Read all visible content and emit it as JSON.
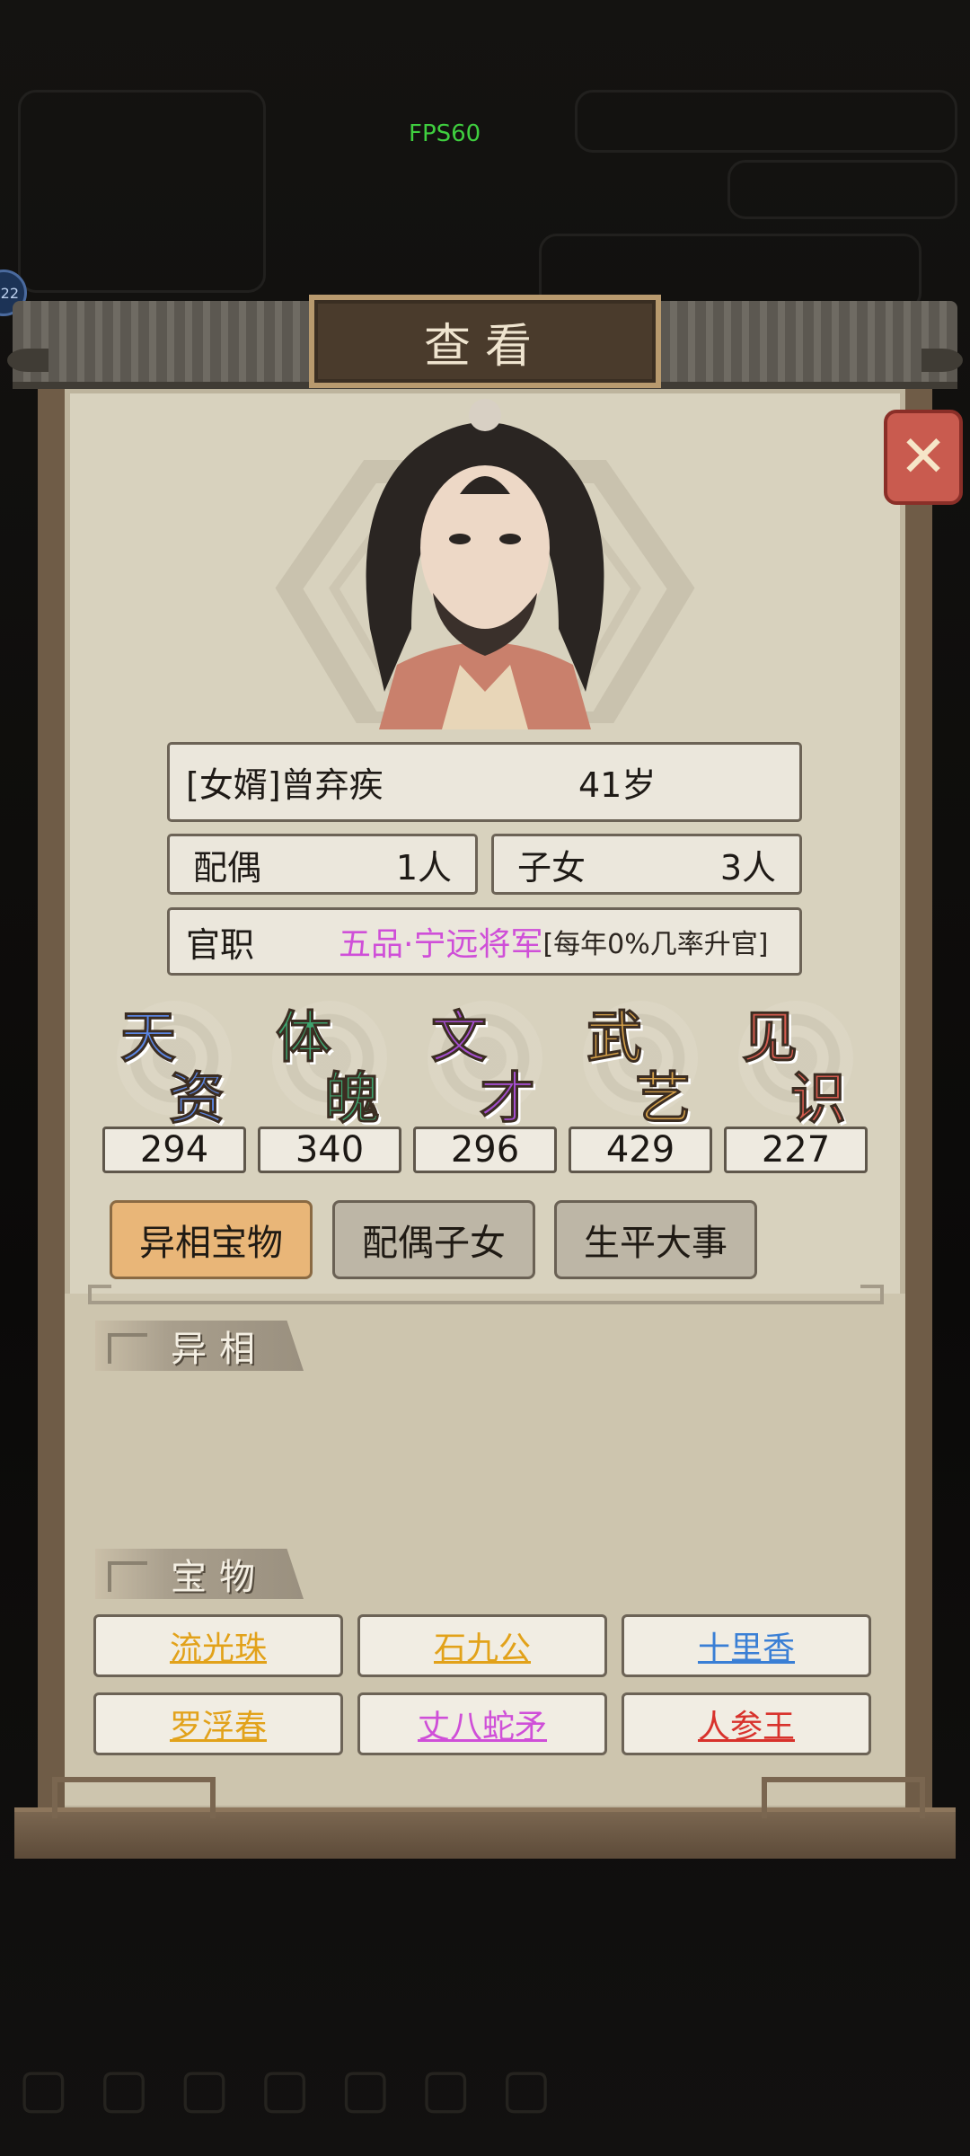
{
  "hud": {
    "fps": "FPS60",
    "left_badge": "22"
  },
  "dialog": {
    "title": "查看"
  },
  "character": {
    "name": "[女婿]曾弃疾",
    "age": "41岁",
    "spouse_label": "配偶",
    "spouse_value": "1人",
    "children_label": "子女",
    "children_value": "3人",
    "office_label": "官职",
    "office_rank": "五品·宁远将军",
    "office_note": "[每年0%几率升官]"
  },
  "stats": [
    {
      "char1": "天",
      "char2": "资",
      "value": "294",
      "color": "#5b86e3"
    },
    {
      "char1": "体",
      "char2": "魄",
      "value": "340",
      "color": "#3ea36e"
    },
    {
      "char1": "文",
      "char2": "才",
      "value": "296",
      "color": "#a44ecf"
    },
    {
      "char1": "武",
      "char2": "艺",
      "value": "429",
      "color": "#d7a24a"
    },
    {
      "char1": "见",
      "char2": "识",
      "value": "227",
      "color": "#d65c50"
    }
  ],
  "tabs": [
    {
      "label": "异相宝物",
      "active": true
    },
    {
      "label": "配偶子女",
      "active": false
    },
    {
      "label": "生平大事",
      "active": false
    }
  ],
  "sections": {
    "traits_title": "异相",
    "treasures_title": "宝物"
  },
  "treasures": [
    {
      "name": "流光珠",
      "color": "#e2a21a"
    },
    {
      "name": "石九公",
      "color": "#e2a21a"
    },
    {
      "name": "十里香",
      "color": "#3a7fd5"
    },
    {
      "name": "罗浮春",
      "color": "#e2a21a"
    },
    {
      "name": "丈八蛇矛",
      "color": "#cf4fd8"
    },
    {
      "name": "人参王",
      "color": "#d8322c"
    }
  ]
}
